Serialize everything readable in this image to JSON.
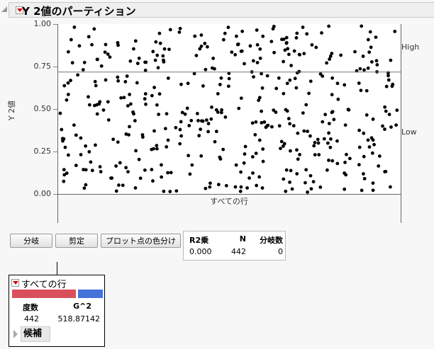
{
  "title": "Y 2値のパーティション",
  "y_label": "Y 2値",
  "y_ticks": [
    "1.00",
    "0.75",
    "0.50",
    "0.25",
    "0.00"
  ],
  "level_labels": {
    "high": "High",
    "low": "Low"
  },
  "x_label": "すべての行",
  "buttons": {
    "split": "分岐",
    "prune": "剪定",
    "color_points": "プロット点の色分け"
  },
  "stats": {
    "headers": [
      "R2乗",
      "N",
      "分岐数"
    ],
    "values": [
      "0.000",
      "442",
      "0"
    ]
  },
  "node": {
    "title": "すべての行",
    "headers": [
      "度数",
      "G^2"
    ],
    "values": [
      "442",
      "518.87142"
    ],
    "candidates": "候補",
    "low_fraction": 0.72,
    "colors": {
      "low": "#d9505c",
      "high": "#4472d8"
    }
  },
  "chart_data": {
    "type": "scatter",
    "n_points": 442,
    "ylim": [
      0,
      1
    ],
    "split_line_y": 0.72,
    "distribution": "uniform random y in [0,1], jittered x",
    "ylabel": "Y 2値",
    "xlabel": "すべての行"
  }
}
